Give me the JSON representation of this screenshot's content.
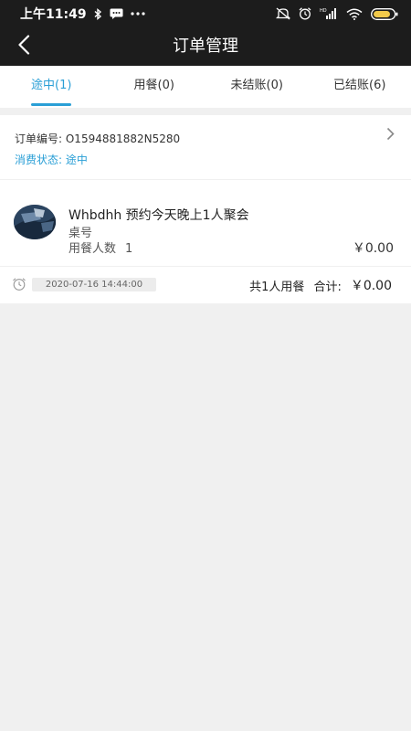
{
  "status_bar": {
    "time": "上午11:49",
    "network_label": "HD"
  },
  "titlebar": {
    "title": "订单管理"
  },
  "tabs": [
    {
      "label": "途中(1)",
      "active": true
    },
    {
      "label": "用餐(0)",
      "active": false
    },
    {
      "label": "未结账(0)",
      "active": false
    },
    {
      "label": "已结账(6)",
      "active": false
    }
  ],
  "order": {
    "number_label": "订单编号: ",
    "number_value": "O1594881882N5280",
    "status_label": "消费状态: ",
    "status_value": "途中",
    "title": "Whbdhh 预约今天晚上1人聚会",
    "table_label": "桌号",
    "people_label": "用餐人数",
    "people_value": "1",
    "price": "￥0.00",
    "datetime": "2020-07-16 14:44:00",
    "summary_people": "共1人用餐",
    "total_label": "合计:",
    "total_value": "￥0.00"
  },
  "colors": {
    "accent": "#2a9fd6",
    "bar_bg": "#1c1c1c",
    "page_bg": "#f0f0f0"
  },
  "icons": [
    "bluetooth-icon",
    "message-icon",
    "more-icon",
    "mute-icon",
    "alarm-icon",
    "signal-icon",
    "wifi-icon",
    "battery-icon",
    "back-arrow-icon",
    "chevron-right-icon",
    "clock-icon"
  ]
}
